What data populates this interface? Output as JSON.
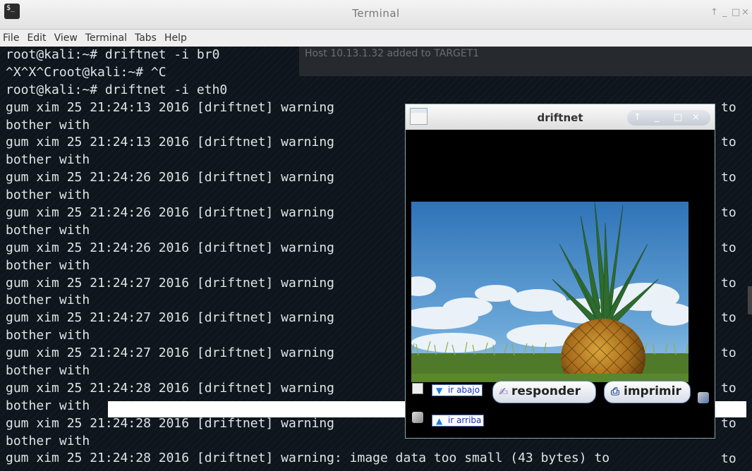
{
  "window": {
    "title": "Terminal",
    "controls": [
      "↑",
      "_",
      "□",
      "×"
    ]
  },
  "menu": [
    "File",
    "Edit",
    "View",
    "Terminal",
    "Tabs",
    "Help"
  ],
  "notification": "Host 10.13.1.32 added to TARGET1",
  "terminal": {
    "lines": [
      "root@kali:~# driftnet -i br0",
      "^X^X^Croot@kali:~# ^C",
      "root@kali:~# driftnet -i eth0",
      "gum xim 25 21:24:13 2016 [driftnet] warning",
      "bother with",
      "gum xim 25 21:24:13 2016 [driftnet] warning",
      "bother with",
      "gum xim 25 21:24:26 2016 [driftnet] warning",
      "bother with",
      "gum xim 25 21:24:26 2016 [driftnet] warning",
      "bother with",
      "gum xim 25 21:24:26 2016 [driftnet] warning",
      "bother with",
      "gum xim 25 21:24:27 2016 [driftnet] warning",
      "bother with",
      "gum xim 25 21:24:27 2016 [driftnet] warning",
      "bother with",
      "gum xim 25 21:24:27 2016 [driftnet] warning",
      "bother with",
      "gum xim 25 21:24:28 2016 [driftnet] warning",
      "bother with",
      "gum xim 25 21:24:28 2016 [driftnet] warning",
      "bother with",
      "gum xim 25 21:24:28 2016 [driftnet] warning: image data too small (43 bytes) to"
    ],
    "right_fragments": [
      "to",
      "",
      "to",
      "",
      "to",
      "",
      "to",
      "",
      "to",
      "",
      "to",
      "",
      "to",
      "",
      "to",
      "",
      "to",
      "",
      "to",
      "",
      "to"
    ]
  },
  "driftnet": {
    "title": "driftnet",
    "controls": [
      "↑",
      "_",
      "□",
      "×"
    ],
    "buttons": {
      "ir_abajo": "ir abajo",
      "ir_arriba": "ir arriba",
      "responder": "responder",
      "imprimir": "imprimir"
    }
  }
}
